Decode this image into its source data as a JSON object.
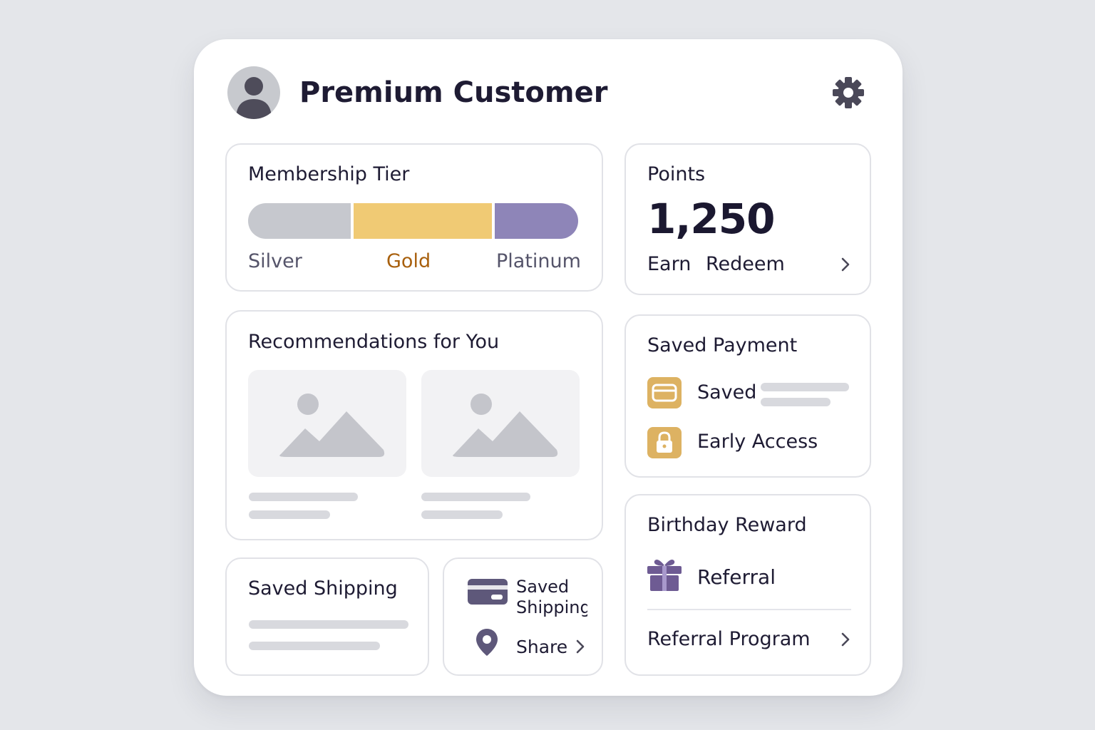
{
  "header": {
    "title": "Premium Customer",
    "avatar_icon": "user-avatar-icon",
    "settings_icon": "gear-icon"
  },
  "membership": {
    "title": "Membership Tier",
    "tiers": [
      {
        "label": "Silver",
        "color": "#c6c8ce",
        "text_color": "#55546a"
      },
      {
        "label": "Gold",
        "color": "#f0ca74",
        "text_color": "#a8600e"
      },
      {
        "label": "Platinum",
        "color": "#8e85b8",
        "text_color": "#55546a"
      }
    ],
    "current_tier": "Gold"
  },
  "points": {
    "title": "Points",
    "value": "1,250",
    "earn_label": "Earn",
    "redeem_label": "Redeem",
    "chevron_icon": "chevron-right-icon"
  },
  "recommendations": {
    "title": "Recommendations for You",
    "items": [
      {
        "icon": "image-placeholder-icon"
      },
      {
        "icon": "image-placeholder-icon"
      }
    ]
  },
  "saved_payment": {
    "title": "Saved Payment",
    "rows": [
      {
        "label": "Saved",
        "icon": "credit-card-icon"
      },
      {
        "label": "Early Access",
        "icon": "lock-icon"
      }
    ]
  },
  "birthday": {
    "title": "Birthday Reward",
    "referral_label": "Referral",
    "gift_icon": "gift-icon",
    "program_label": "Referral Program",
    "chevron_icon": "chevron-right-icon"
  },
  "saved_shipping": {
    "title": "Saved Shipping"
  },
  "shipping_actions": {
    "card_label": "Saved Shipping",
    "card_icon": "credit-card-icon",
    "share_label": "Share",
    "location_icon": "map-pin-icon",
    "chevron_icon": "chevron-right-icon"
  },
  "colors": {
    "background": "#e4e6ea",
    "accent_purple": "#6e5b93",
    "accent_gold": "#ddb262",
    "text_dark": "#1e1b33"
  }
}
